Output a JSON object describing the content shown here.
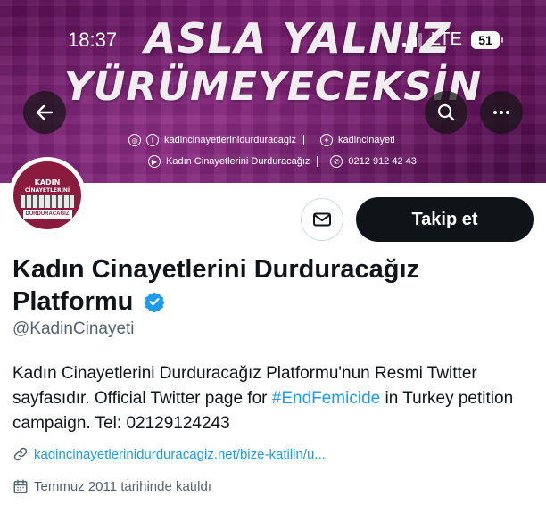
{
  "status_bar": {
    "time": "18:37",
    "network": "LTE",
    "battery": "51"
  },
  "banner": {
    "line1": "ASLA YALNIZ",
    "line2": "YÜRÜMEYECEKSİN",
    "website": "kadincinayetlerinidurduracagiz",
    "twitter": "kadincinayeti",
    "youtube": "Kadın Cinayetlerini Durduracağız",
    "phone": "0212 912 42 43"
  },
  "avatar": {
    "line1": "KADIN",
    "line2": "CİNAYETLERİNİ",
    "line3": "DURDURACAĞIZ"
  },
  "actions": {
    "follow_label": "Takip et"
  },
  "profile": {
    "name": "Kadın Cinayetlerini Durduracağız Platformu",
    "handle": "@KadinCinayeti",
    "bio_part1": "Kadın Cinayetlerini Durduracağız Platformu'nun Resmi Twitter sayfasıdır. Official Twitter page for ",
    "bio_hashtag": "#EndFemicide",
    "bio_part2": " in Turkey petition campaign. Tel: 02129124243",
    "link": "kadincinayetlerinidurduracagiz.net/bize-katilin/u...",
    "joined": "Temmuz 2011 tarihinde katıldı"
  },
  "colors": {
    "accent": "#1d9bf0",
    "banner": "#7c1f74",
    "follow_button": "#0f1419",
    "secondary_text": "#536471"
  },
  "icons": {
    "back": "arrow-left-icon",
    "search": "search-icon",
    "more": "more-horizontal-icon",
    "message": "envelope-icon",
    "verified": "verified-badge-icon",
    "link": "link-icon",
    "calendar": "calendar-icon"
  }
}
